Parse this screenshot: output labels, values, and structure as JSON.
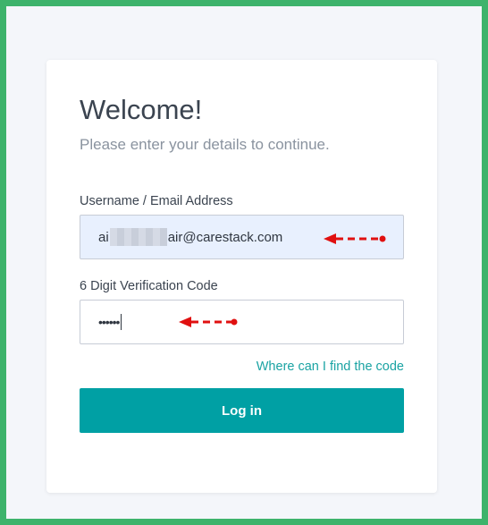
{
  "login_card": {
    "title": "Welcome!",
    "subtitle": "Please enter your details to continue.",
    "username_label": "Username / Email Address",
    "username_value_prefix": "ai",
    "username_value_suffix": "air@carestack.com",
    "code_label": "6 Digit Verification Code",
    "code_value_masked": "••••••",
    "find_code_link": "Where can I find the code",
    "login_button": "Log in"
  },
  "colors": {
    "frame_border": "#3db36b",
    "accent": "#00a0a4",
    "link": "#1aa3a3",
    "annotation_arrow": "#e01010",
    "autofill_bg": "#e8f0fe"
  },
  "icons": [
    "red-dashed-arrow-icon"
  ]
}
